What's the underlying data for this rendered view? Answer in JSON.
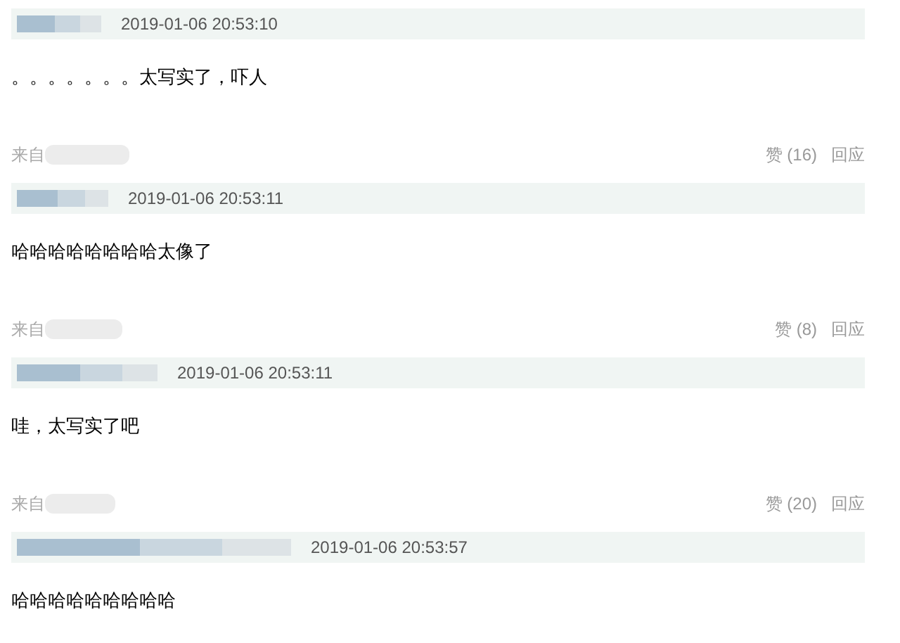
{
  "comments": [
    {
      "time": "2019-01-06 20:53:10",
      "text": "。。。。。。。太写实了，吓人",
      "footer": {
        "source_label": "来自",
        "like": "赞 (16)",
        "reply": "回应"
      }
    },
    {
      "time": "2019-01-06 20:53:11",
      "text": "哈哈哈哈哈哈哈哈太像了",
      "footer": {
        "source_label": "来自",
        "like": "赞 (8)",
        "reply": "回应"
      }
    },
    {
      "time": "2019-01-06 20:53:11",
      "text": "哇，太写实了吧",
      "footer": {
        "source_label": "来自",
        "like": "赞 (20)",
        "reply": "回应"
      }
    },
    {
      "time": "2019-01-06 20:53:57",
      "text": "哈哈哈哈哈哈哈哈哈"
    }
  ]
}
